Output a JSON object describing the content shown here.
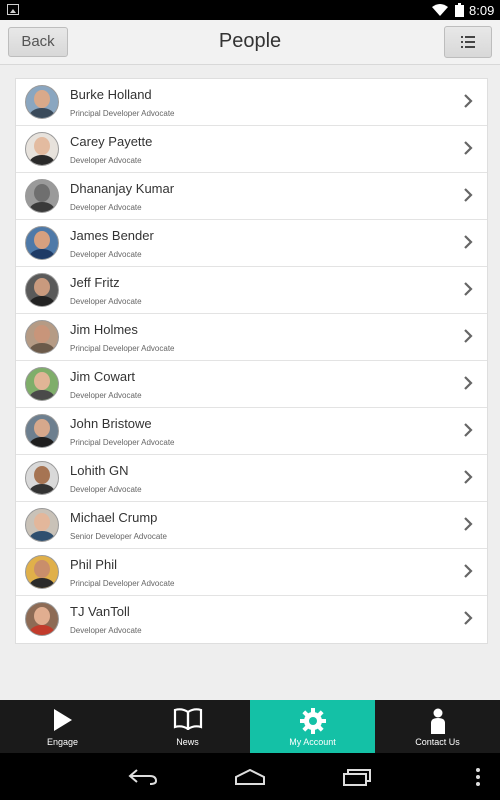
{
  "status_bar": {
    "time": "8:09"
  },
  "nav": {
    "back_label": "Back",
    "title": "People"
  },
  "people": [
    {
      "name": "Burke Holland",
      "role": "Principal Developer Advocate",
      "bg": "#8aa6c0",
      "skin": "#d9a98a",
      "shirt": "#3a4a5a"
    },
    {
      "name": "Carey Payette",
      "role": "Developer Advocate",
      "bg": "#e7e2dc",
      "skin": "#e3bba0",
      "shirt": "#2a2a2a"
    },
    {
      "name": "Dhananjay Kumar",
      "role": "Developer Advocate",
      "bg": "#9a9a9a",
      "skin": "#6f6f6f",
      "shirt": "#3a3a3a"
    },
    {
      "name": "James Bender",
      "role": "Developer Advocate",
      "bg": "#4e79a8",
      "skin": "#d7a07f",
      "shirt": "#1f3b66"
    },
    {
      "name": "Jeff Fritz",
      "role": "Developer Advocate",
      "bg": "#5a5a5a",
      "skin": "#c99a7e",
      "shirt": "#222222"
    },
    {
      "name": "Jim Holmes",
      "role": "Principal Developer Advocate",
      "bg": "#b59b85",
      "skin": "#c8957a",
      "shirt": "#6b5a4a"
    },
    {
      "name": "Jim Cowart",
      "role": "Developer Advocate",
      "bg": "#7fae6a",
      "skin": "#e0b596",
      "shirt": "#4a4a4a"
    },
    {
      "name": "John Bristowe",
      "role": "Principal Developer Advocate",
      "bg": "#6d7f8f",
      "skin": "#d6a88c",
      "shirt": "#1e1e1e"
    },
    {
      "name": "Lohith GN",
      "role": "Developer Advocate",
      "bg": "#d9d9d9",
      "skin": "#a67453",
      "shirt": "#333333"
    },
    {
      "name": "Michael Crump",
      "role": "Senior Developer Advocate",
      "bg": "#c9c2b8",
      "skin": "#e3b79b",
      "shirt": "#2f4f6f"
    },
    {
      "name": "Phil Phil",
      "role": "Principal Developer Advocate",
      "bg": "#e0b04a",
      "skin": "#c98e6b",
      "shirt": "#2b2b2b"
    },
    {
      "name": "TJ VanToll",
      "role": "Developer Advocate",
      "bg": "#8d6b55",
      "skin": "#e1ae90",
      "shirt": "#c23b2b"
    }
  ],
  "tabs": [
    {
      "label": "Engage",
      "icon": "play-icon",
      "active": false
    },
    {
      "label": "News",
      "icon": "book-icon",
      "active": false
    },
    {
      "label": "My Account",
      "icon": "gear-icon",
      "active": true
    },
    {
      "label": "Contact Us",
      "icon": "person-icon",
      "active": false
    }
  ],
  "colors": {
    "accent": "#14c1a6",
    "tabbar": "#1a1a1a"
  }
}
